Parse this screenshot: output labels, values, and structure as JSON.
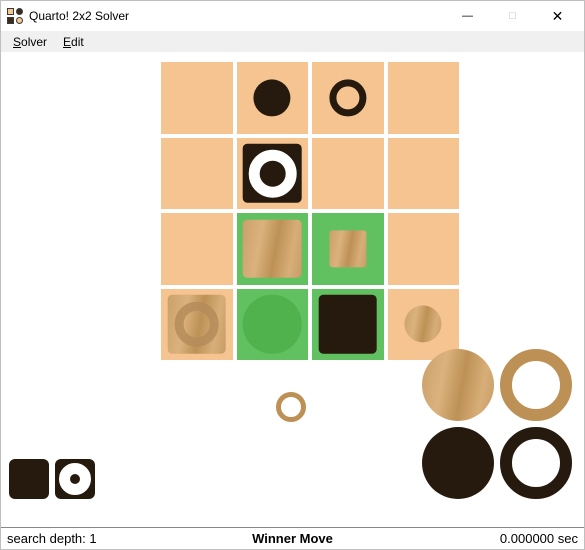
{
  "window": {
    "title": "Quarto! 2x2 Solver",
    "controls": {
      "min": "—",
      "max": "□",
      "close": "✕"
    }
  },
  "menu": {
    "solver": "Solver",
    "edit": "Edit"
  },
  "status": {
    "depth_label": "search depth: 1",
    "result": "Winner Move",
    "time": "0.000000 sec"
  },
  "colors": {
    "cell": "#f6c491",
    "highlight": "#61c05f",
    "dark_piece": "#261a0e",
    "light_piece": "#c79c66"
  },
  "board_layout": "4x4",
  "board": [
    [
      null,
      {
        "size": "short",
        "shape": "round",
        "color": "dark",
        "fill": "solid"
      },
      {
        "size": "short",
        "shape": "round",
        "color": "dark",
        "fill": "hollow"
      },
      null
    ],
    [
      null,
      {
        "size": "tall",
        "shape": "square",
        "color": "dark",
        "fill": "solid",
        "inner": "white-ring"
      },
      null,
      null
    ],
    [
      null,
      {
        "size": "tall",
        "shape": "square",
        "color": "light",
        "fill": "solid",
        "highlight": true
      },
      {
        "size": "short",
        "shape": "square",
        "color": "light",
        "fill": "solid",
        "highlight": true
      },
      null
    ],
    [
      {
        "size": "tall",
        "shape": "square",
        "color": "light",
        "fill": "solid",
        "inner": "ring"
      },
      {
        "size": "tall",
        "shape": "round",
        "color": "green",
        "fill": "solid",
        "highlight": true
      },
      {
        "size": "tall",
        "shape": "square",
        "color": "dark",
        "fill": "solid",
        "highlight": true
      },
      {
        "size": "short",
        "shape": "round",
        "color": "light",
        "fill": "solid"
      }
    ]
  ],
  "next_piece": {
    "size": "short",
    "shape": "round",
    "color": "light",
    "fill": "hollow"
  },
  "tray_bottom_left": [
    {
      "size": "small",
      "shape": "square",
      "color": "dark",
      "fill": "solid"
    },
    {
      "size": "small",
      "shape": "square",
      "color": "dark",
      "fill": "solid",
      "inner": "white-ring"
    }
  ],
  "tray_bottom_right": [
    {
      "shape": "round",
      "color": "light",
      "fill": "solid"
    },
    {
      "shape": "round",
      "color": "light",
      "fill": "hollow"
    },
    {
      "shape": "round",
      "color": "dark",
      "fill": "solid"
    },
    {
      "shape": "round",
      "color": "dark",
      "fill": "hollow"
    }
  ]
}
